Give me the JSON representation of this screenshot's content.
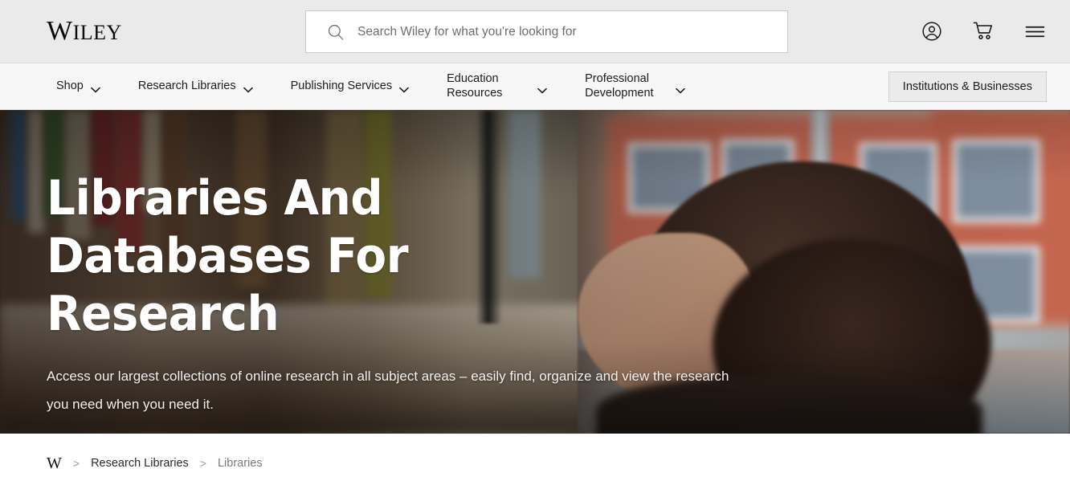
{
  "header": {
    "logo_cap": "W",
    "logo_rest": "ILEY",
    "logo_alt": "Wiley",
    "search": {
      "placeholder": "Search Wiley for what you're looking for",
      "value": "",
      "icon": "search-icon"
    },
    "actions": [
      {
        "name": "account-icon",
        "label": "Account"
      },
      {
        "name": "cart-icon",
        "label": "Shopping cart"
      },
      {
        "name": "hamburger-menu-icon",
        "label": "Menu"
      }
    ]
  },
  "nav": {
    "items": [
      {
        "label": "Shop",
        "has_caret": true,
        "two_line": false
      },
      {
        "label": "Research Libraries",
        "has_caret": true,
        "two_line": false
      },
      {
        "label": "Publishing Services",
        "has_caret": true,
        "two_line": false
      },
      {
        "label": "Education Resources",
        "has_caret": true,
        "two_line": true
      },
      {
        "label": "Professional Development",
        "has_caret": true,
        "two_line": true
      }
    ],
    "institutions_button": "Institutions & Businesses"
  },
  "hero": {
    "title": "Libraries And Databases For Research",
    "subtitle": "Access our largest collections of online research in all subject areas – easily find, organize and view the research you need when you need it.",
    "image_alt": "Woman in profile beside library bookshelves and a window"
  },
  "breadcrumb": {
    "home": "W",
    "separator": ">",
    "items": [
      {
        "label": "Research Libraries",
        "current": false
      },
      {
        "label": "Libraries",
        "current": true
      }
    ]
  },
  "colors": {
    "header_bg": "#eaeaea",
    "nav_bg": "#f7f7f7",
    "button_bg": "#ebebeb",
    "text": "#1c1c1c",
    "hero_text": "#ffffff",
    "crumb_current": "#7a7a7a"
  }
}
